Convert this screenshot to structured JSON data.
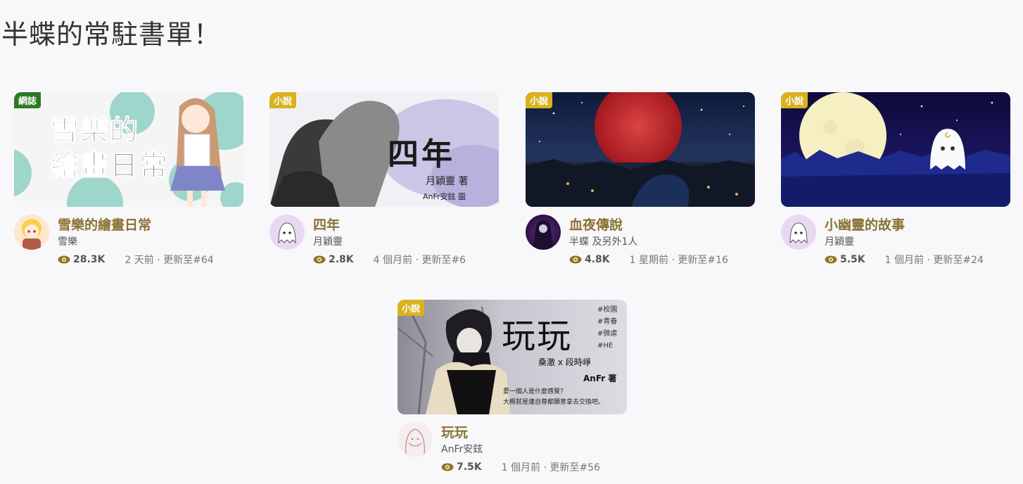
{
  "page": {
    "title": "半蝶的常駐書單！"
  },
  "books": [
    {
      "badge": "網誌",
      "title": "雪樂的繪畫日常",
      "author": "雪樂",
      "views": "28.3K",
      "updated": "2 天前 · 更新至#64",
      "cover_text": "雪樂的\n繪畫日常"
    },
    {
      "badge": "小說",
      "title": "四年",
      "author": "月穎靈",
      "views": "2.8K",
      "updated": "4 個月前 · 更新至#6",
      "cover_title": "四年",
      "cover_author": "月穎靈 著",
      "cover_illust": "AnFr安鉉 圖"
    },
    {
      "badge": "小說",
      "title": "血夜傳說",
      "author": "半蝶 及另外1人",
      "views": "4.8K",
      "updated": "1 星期前 · 更新至#16"
    },
    {
      "badge": "小說",
      "title": "小幽靈的故事",
      "author": "月穎靈",
      "views": "5.5K",
      "updated": "1 個月前 · 更新至#24"
    },
    {
      "badge": "小說",
      "title": "玩玩",
      "author": "AnFr安鉉",
      "views": "7.5K",
      "updated": "1 個月前 · 更新至#56",
      "cover_title": "玩玩",
      "cover_tags": "#校園\n#青春\n#微虐\n#HE",
      "cover_names": "桑澈 x 段時崢",
      "cover_author": "AnFr 著",
      "cover_quote": "愛一個人是什麼感覺？\n大概就是連自尊都願意拿去交換吧。"
    }
  ]
}
